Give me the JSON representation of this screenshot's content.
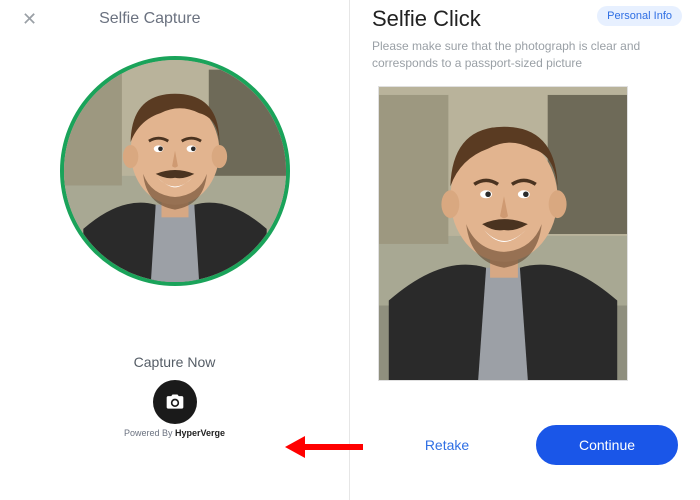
{
  "left": {
    "title": "Selfie Capture",
    "close_label": "✕",
    "capture_label": "Capture Now",
    "powered_prefix": "Powered By ",
    "powered_brand": "HyperVerge",
    "ring_color": "#1aa35a"
  },
  "right": {
    "title": "Selfie Click",
    "badge": "Personal Info",
    "instructions": "Please make sure that the photograph is clear and corresponds to a passport-sized picture",
    "retake_label": "Retake",
    "continue_label": "Continue"
  },
  "colors": {
    "primary": "#1a56e8",
    "badge_bg": "#e7f0ff",
    "badge_fg": "#2f6fe4",
    "arrow": "#ff0000"
  }
}
